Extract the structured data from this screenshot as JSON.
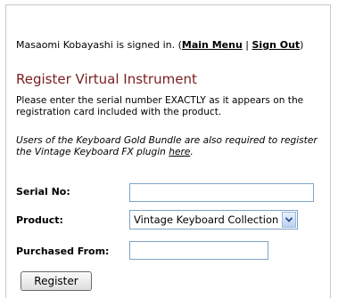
{
  "session": {
    "user_text": "Masaomi Kobayashi is signed in. (",
    "main_menu_link": "Main Menu",
    "separator": " | ",
    "sign_out_link": "Sign Out",
    "close_paren": ")"
  },
  "page": {
    "title": "Register Virtual Instrument",
    "instructions": "Please enter the serial number EXACTLY as it appears on the registration card included with the product.",
    "bundle_note_text": "Users of the Keyboard Gold Bundle are also required to register the Vintage Keyboard FX plugin ",
    "bundle_note_link": "here",
    "bundle_note_end": "."
  },
  "form": {
    "serial_label": "Serial No:",
    "serial_value": "",
    "product_label": "Product:",
    "product_selected": "Vintage Keyboard Collection",
    "purchased_label": "Purchased From:",
    "purchased_value": "",
    "submit_label": "Register"
  },
  "colors": {
    "title": "#7a2020",
    "field_border": "#7fa3c8"
  }
}
